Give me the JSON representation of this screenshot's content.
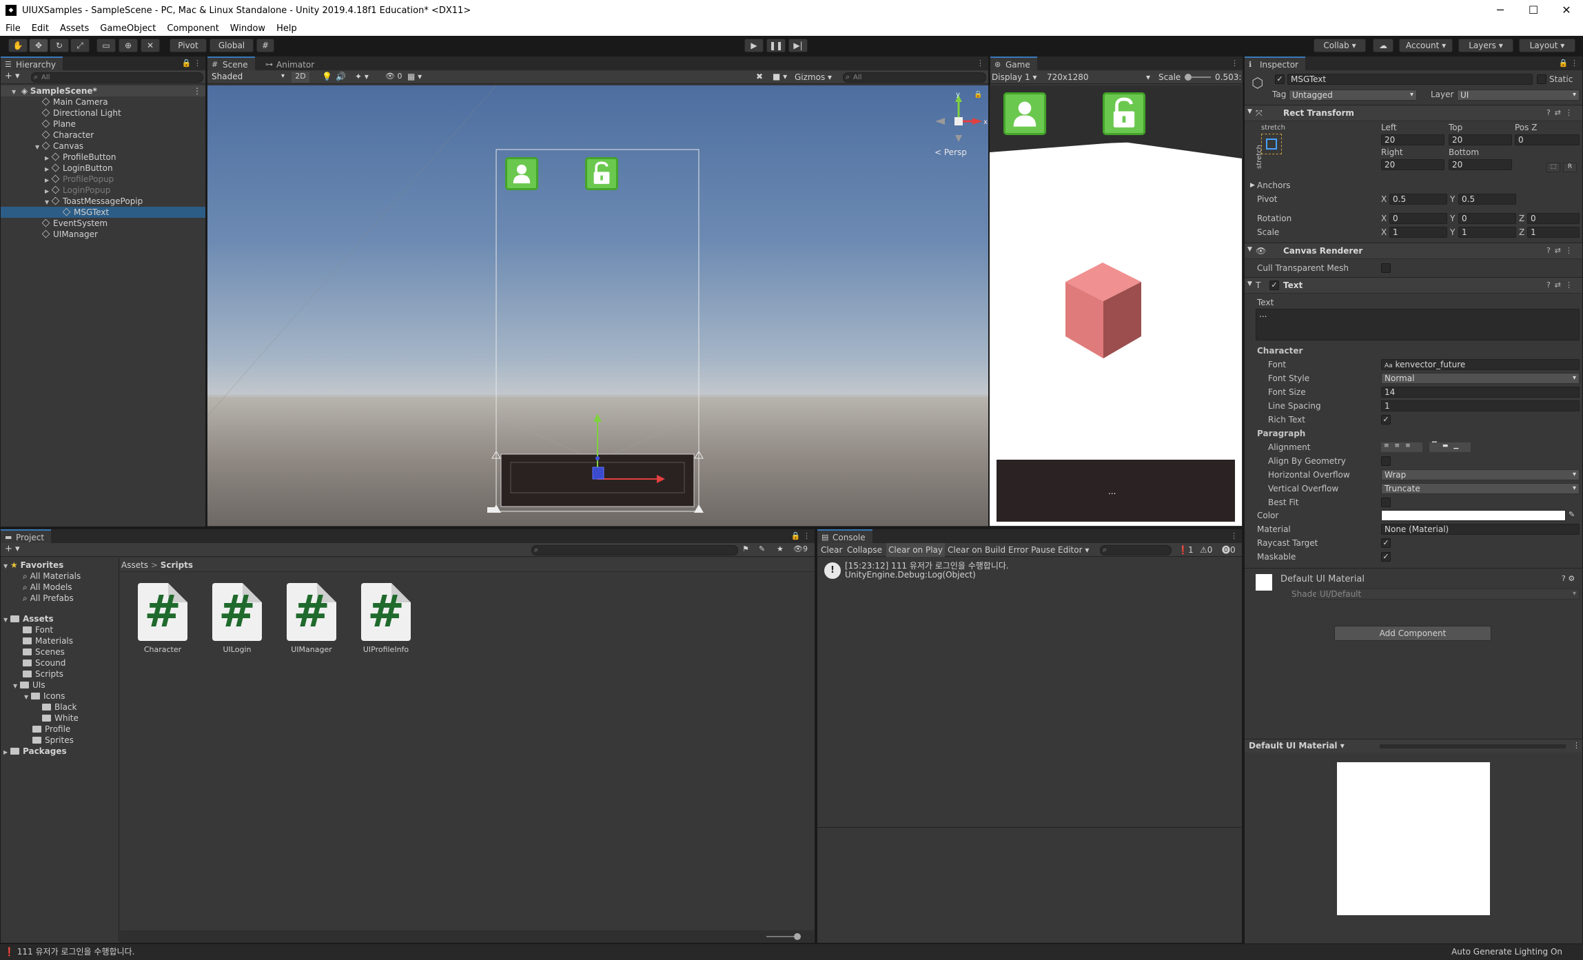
{
  "window": {
    "title": "UIUXSamples - SampleScene - PC, Mac & Linux Standalone - Unity 2019.4.18f1 Education* <DX11>",
    "min": "─",
    "max": "☐",
    "close": "✕"
  },
  "menu": [
    "File",
    "Edit",
    "Assets",
    "GameObject",
    "Component",
    "Window",
    "Help"
  ],
  "toolbar": {
    "pivot": "Pivot",
    "global": "Global",
    "collab": "Collab",
    "account": "Account",
    "layers": "Layers",
    "layout": "Layout"
  },
  "hierarchy": {
    "tab": "Hierarchy",
    "search_placeholder": "All",
    "scene": "SampleScene*",
    "items": [
      {
        "label": "Main Camera"
      },
      {
        "label": "Directional Light"
      },
      {
        "label": "Plane"
      },
      {
        "label": "Character"
      },
      {
        "label": "Canvas"
      },
      {
        "label": "ProfileButton"
      },
      {
        "label": "LoginButton"
      },
      {
        "label": "ProfilePopup"
      },
      {
        "label": "LoginPopup"
      },
      {
        "label": "ToastMessagePopip"
      },
      {
        "label": "MSGText"
      },
      {
        "label": "EventSystem"
      },
      {
        "label": "UIManager"
      }
    ]
  },
  "scene": {
    "tab": "Scene",
    "tab2": "Animator",
    "shading": "Shaded",
    "mode2d": "2D",
    "hidden_count": "0",
    "gizmos": "Gizmos",
    "search_placeholder": "All",
    "persp": "< Persp",
    "gizmo_y": "y",
    "gizmo_x": "x"
  },
  "game": {
    "tab": "Game",
    "display": "Display 1",
    "resolution": "720x1280",
    "scale_label": "Scale",
    "scale_value": "0.503:",
    "toast_text": "..."
  },
  "inspector": {
    "tab": "Inspector",
    "object_name": "MSGText",
    "static": "Static",
    "tag_label": "Tag",
    "tag_value": "Untagged",
    "layer_label": "Layer",
    "layer_value": "UI",
    "rect_transform": {
      "title": "Rect Transform",
      "stretch_h": "stretch",
      "stretch_v": "stretch",
      "left_label": "Left",
      "left": "20",
      "top_label": "Top",
      "top": "20",
      "posz_label": "Pos Z",
      "posz": "0",
      "right_label": "Right",
      "right": "20",
      "bottom_label": "Bottom",
      "bottom": "20",
      "anchors": "Anchors",
      "pivot_label": "Pivot",
      "pivot_x": "0.5",
      "pivot_y": "0.5",
      "rotation_label": "Rotation",
      "rot_x": "0",
      "rot_y": "0",
      "rot_z": "0",
      "scale_label": "Scale",
      "scale_x": "1",
      "scale_y": "1",
      "scale_z": "1",
      "r_button": "R"
    },
    "canvas_renderer": {
      "title": "Canvas Renderer",
      "cull_label": "Cull Transparent Mesh"
    },
    "text": {
      "title": "Text",
      "text_label": "Text",
      "text_value": "...",
      "character": "Character",
      "font_label": "Font",
      "font": "kenvector_future",
      "font_style_label": "Font Style",
      "font_style": "Normal",
      "font_size_label": "Font Size",
      "font_size": "14",
      "line_spacing_label": "Line Spacing",
      "line_spacing": "1",
      "rich_text_label": "Rich Text",
      "paragraph": "Paragraph",
      "alignment_label": "Alignment",
      "align_geom_label": "Align By Geometry",
      "hoverflow_label": "Horizontal Overflow",
      "hoverflow": "Wrap",
      "voverflow_label": "Vertical Overflow",
      "voverflow": "Truncate",
      "bestfit_label": "Best Fit",
      "color_label": "Color",
      "material_label": "Material",
      "material": "None (Material)",
      "raycast_label": "Raycast Target",
      "maskable_label": "Maskable"
    },
    "material_block": {
      "name": "Default UI Material",
      "shader_label": "Shader",
      "shader": "UI/Default"
    },
    "add_component": "Add Component",
    "preview_title": "Default UI Material"
  },
  "project": {
    "tab": "Project",
    "favorites": "Favorites",
    "fav_items": [
      "All Materials",
      "All Models",
      "All Prefabs"
    ],
    "assets": "Assets",
    "folders": [
      {
        "label": "Font",
        "depth": 1
      },
      {
        "label": "Materials",
        "depth": 1
      },
      {
        "label": "Scenes",
        "depth": 1
      },
      {
        "label": "Scound",
        "depth": 1
      },
      {
        "label": "Scripts",
        "depth": 1
      },
      {
        "label": "UIs",
        "depth": 1
      },
      {
        "label": "Icons",
        "depth": 2
      },
      {
        "label": "Black",
        "depth": 3
      },
      {
        "label": "White",
        "depth": 3
      },
      {
        "label": "Profile",
        "depth": 2
      },
      {
        "label": "Sprites",
        "depth": 2
      }
    ],
    "packages": "Packages",
    "breadcrumb_root": "Assets",
    "breadcrumb_sep": ">",
    "breadcrumb_leaf": "Scripts",
    "hidden_count": "9",
    "scripts": [
      "Character",
      "UILogin",
      "UIManager",
      "UIProfileInfo"
    ]
  },
  "console": {
    "tab": "Console",
    "buttons": [
      "Clear",
      "Collapse",
      "Clear on Play",
      "Clear on Build",
      "Error Pause",
      "Editor"
    ],
    "info_count": "1",
    "warn_count": "0",
    "error_count": "0",
    "log_line1": "[15:23:12] 111 유저가 로그인을 수행합니다.",
    "log_line2": "UnityEngine.Debug:Log(Object)"
  },
  "status": {
    "message": "111 유저가 로그인을 수행합니다.",
    "lighting": "Auto Generate Lighting On"
  },
  "colors": {
    "accent_tab": "#3a79bb",
    "selection": "#2c5d87",
    "button_green": "#6bc84f",
    "cube": "#e07b7b"
  }
}
